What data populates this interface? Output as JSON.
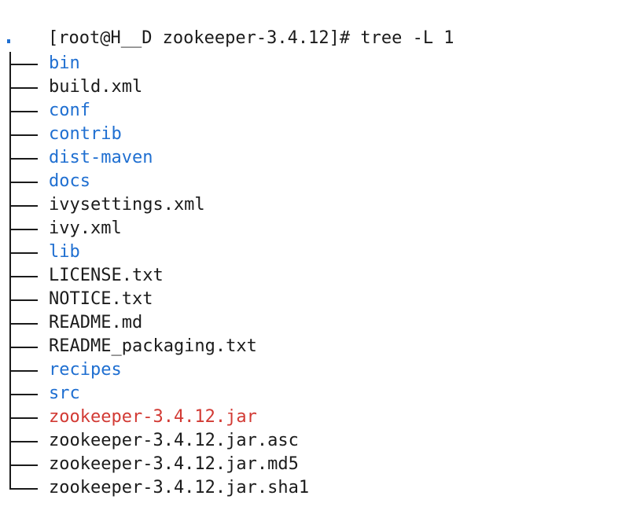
{
  "terminal": {
    "prompt": "[root@H__D zookeeper-3.4.12]# ",
    "command": "tree -L 1",
    "root": ".",
    "colors": {
      "background": "#ffffff",
      "text": "#1b1b1b",
      "directory": "#1f6fd1",
      "archive": "#d23a34"
    },
    "entries": [
      {
        "name": "bin",
        "kind": "dir"
      },
      {
        "name": "build.xml",
        "kind": "file"
      },
      {
        "name": "conf",
        "kind": "dir"
      },
      {
        "name": "contrib",
        "kind": "dir"
      },
      {
        "name": "dist-maven",
        "kind": "dir"
      },
      {
        "name": "docs",
        "kind": "dir"
      },
      {
        "name": "ivysettings.xml",
        "kind": "file"
      },
      {
        "name": "ivy.xml",
        "kind": "file"
      },
      {
        "name": "lib",
        "kind": "dir"
      },
      {
        "name": "LICENSE.txt",
        "kind": "file"
      },
      {
        "name": "NOTICE.txt",
        "kind": "file"
      },
      {
        "name": "README.md",
        "kind": "file"
      },
      {
        "name": "README_packaging.txt",
        "kind": "file"
      },
      {
        "name": "recipes",
        "kind": "dir"
      },
      {
        "name": "src",
        "kind": "dir"
      },
      {
        "name": "zookeeper-3.4.12.jar",
        "kind": "archive"
      },
      {
        "name": "zookeeper-3.4.12.jar.asc",
        "kind": "file"
      },
      {
        "name": "zookeeper-3.4.12.jar.md5",
        "kind": "file"
      },
      {
        "name": "zookeeper-3.4.12.jar.sha1",
        "kind": "file"
      }
    ]
  }
}
